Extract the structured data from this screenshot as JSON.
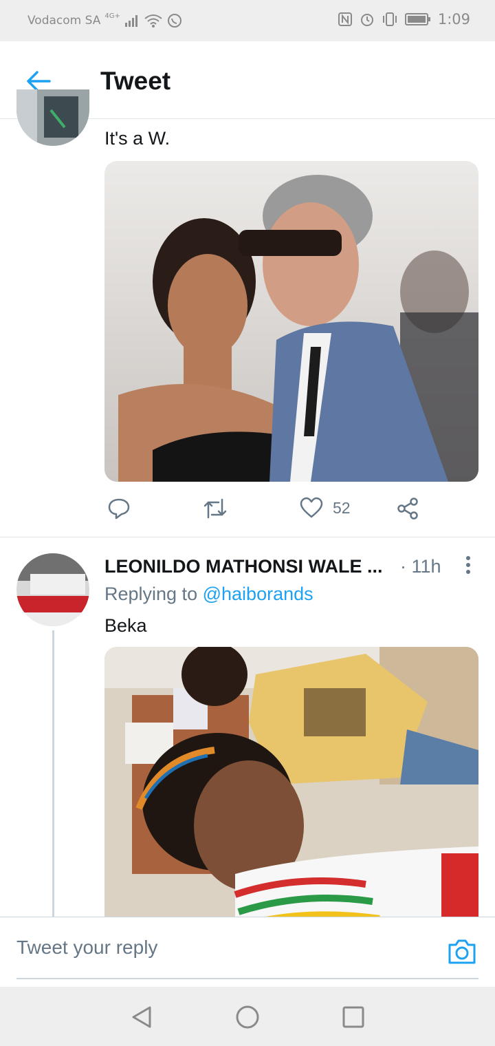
{
  "status_bar": {
    "carrier": "Vodacom SA",
    "network": "4G+",
    "time": "1:09"
  },
  "header": {
    "title": "Tweet"
  },
  "tweet_top": {
    "text": "It's a W.",
    "like_count": "52"
  },
  "tweet_reply": {
    "name": "LEONILDO MATHONSI WALE ...",
    "time": "· 11h",
    "replying_label": "Replying to",
    "replying_handle": "@haiborands",
    "text": "Beka"
  },
  "reply_bar": {
    "placeholder": "Tweet your reply"
  },
  "colors": {
    "accent": "#1da1f2",
    "secondary_text": "#657786",
    "divider": "#e1e8ed"
  },
  "icons": [
    "back-arrow-icon",
    "reply-icon",
    "retweet-icon",
    "like-icon",
    "share-icon",
    "more-icon",
    "camera-icon",
    "nav-back-icon",
    "nav-home-icon",
    "nav-recents-icon"
  ]
}
